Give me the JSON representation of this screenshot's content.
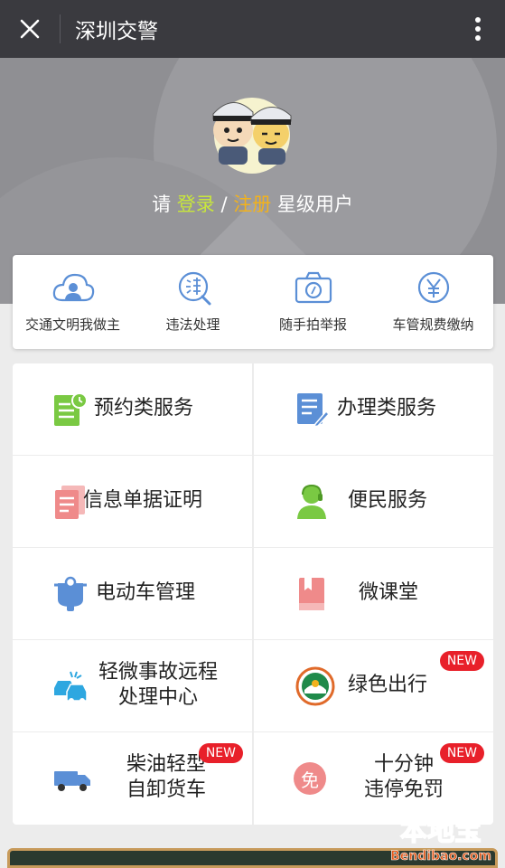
{
  "topbar": {
    "title": "深圳交警",
    "close_icon": "close-icon",
    "more_icon": "more-vertical-icon"
  },
  "header": {
    "prompt_prefix": "请 ",
    "login_label": "登录",
    "slash": " / ",
    "register_label": "注册",
    "suffix": " 星级用户"
  },
  "quick_actions": [
    {
      "label": "交通文明我做主",
      "icon": "cloud-user-icon"
    },
    {
      "label": "违法处理",
      "icon": "violation-search-icon"
    },
    {
      "label": "随手拍举报",
      "icon": "camera-icon"
    },
    {
      "label": "车管规费缴纳",
      "icon": "yuan-icon"
    }
  ],
  "services": {
    "booking": {
      "label": "预约类服务"
    },
    "handling": {
      "label": "办理类服务"
    },
    "info_docs": {
      "label": "信息单据证明"
    },
    "convenience": {
      "label": "便民服务"
    },
    "ebike": {
      "label": "电动车管理"
    },
    "micro_class": {
      "label": "微课堂"
    },
    "minor_accident": {
      "line1": "轻微事故远程",
      "line2": "处理中心"
    },
    "green_travel": {
      "label": "绿色出行",
      "badge": "NEW"
    },
    "diesel_truck": {
      "line1": "柴油轻型",
      "line2": "自卸货车",
      "badge": "NEW"
    },
    "parking": {
      "line1": "十分钟",
      "line2": "违停免罚",
      "badge": "NEW",
      "icon_char": "免"
    }
  },
  "watermark": {
    "brand": "本地宝",
    "url": "Bendibao.com"
  },
  "colors": {
    "green_icon": "#7ac943",
    "blue_icon": "#5b8fd6",
    "red_icon": "#ef8a8a",
    "teal_icon": "#2ea7e0",
    "badge_red": "#e8202a"
  }
}
